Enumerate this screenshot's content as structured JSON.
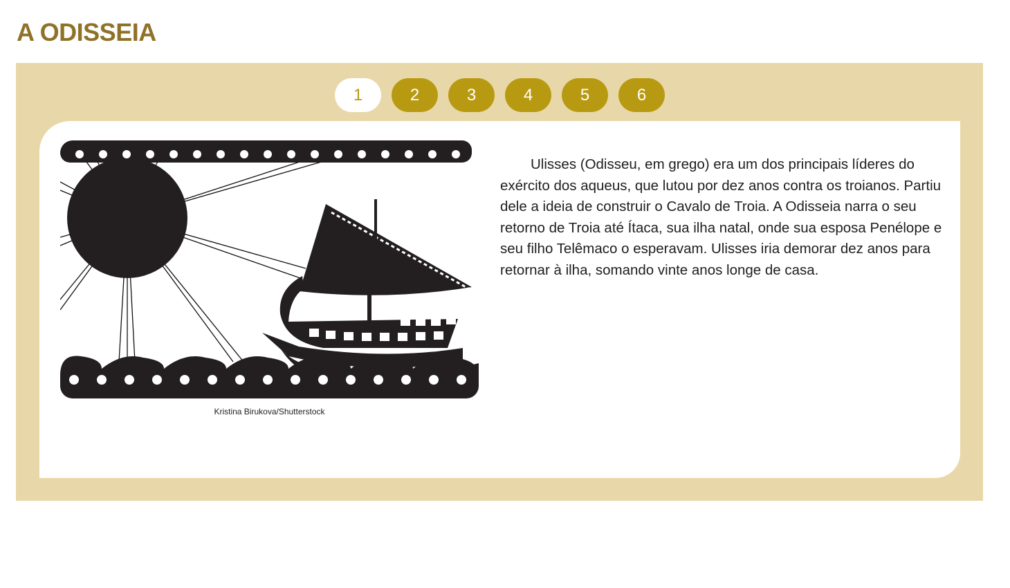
{
  "page": {
    "title": "A ODISSEIA"
  },
  "tabs": [
    {
      "label": "1",
      "active": true
    },
    {
      "label": "2",
      "active": false
    },
    {
      "label": "3",
      "active": false
    },
    {
      "label": "4",
      "active": false
    },
    {
      "label": "5",
      "active": false
    },
    {
      "label": "6",
      "active": false
    }
  ],
  "content": {
    "paragraph": "Ulisses (Odisseu, em grego) era um dos principais líderes do exército dos aqueus, que lutou por dez anos contra os troianos. Partiu dele a ideia de construir o Cavalo de Troia. A Odisseia narra o seu retorno de Troia até Ítaca, sua ilha natal, onde sua esposa Penélope e seu filho Telêmaco o esperavam. Ulisses iria demorar dez anos para retornar à ilha, somando vinte anos longe de casa.",
    "image_credit": "Kristina Birukova/Shutterstock"
  },
  "colors": {
    "title": "#8f7228",
    "frame_background": "#e8d8a9",
    "tab_background": "#b89a12",
    "tab_active_background": "#ffffff"
  }
}
